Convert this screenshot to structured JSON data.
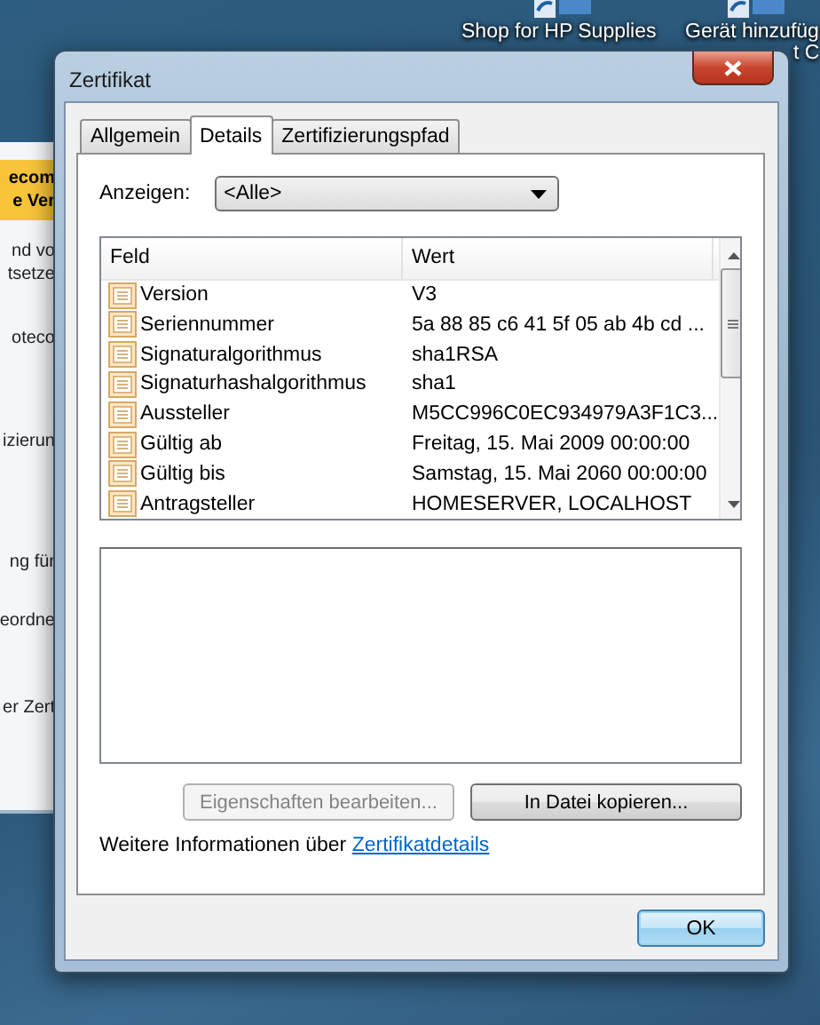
{
  "desktop": {
    "icons": [
      {
        "label": "Shop for HP Supplies"
      },
      {
        "label": "Gerät hinzufüg",
        "label_line_2": "t C"
      }
    ],
    "background_window": {
      "header_lines": [
        "ecom",
        "e Ver"
      ],
      "lines": [
        "nd vo",
        "tsetze",
        "oteco",
        "izierun",
        "ng für",
        "eordne",
        "er Zert"
      ]
    }
  },
  "window": {
    "title": "Zertifikat"
  },
  "tabs": [
    {
      "label": "Allgemein",
      "selected": false
    },
    {
      "label": "Details",
      "selected": true
    },
    {
      "label": "Zertifizierungspfad",
      "selected": false
    }
  ],
  "show_filter": {
    "label": "Anzeigen:",
    "value": "<Alle>"
  },
  "table": {
    "columns": [
      "Feld",
      "Wert"
    ],
    "rows": [
      {
        "field": "Version",
        "value": "V3"
      },
      {
        "field": "Seriennummer",
        "value": "5a 88 85 c6 41 5f 05 ab 4b cd ..."
      },
      {
        "field": "Signaturalgorithmus",
        "value": "sha1RSA"
      },
      {
        "field": "Signaturhashalgorithmus",
        "value": "sha1"
      },
      {
        "field": "Aussteller",
        "value": "M5CC996C0EC934979A3F1C3..."
      },
      {
        "field": "Gültig ab",
        "value": "Freitag, 15. Mai 2009 00:00:00"
      },
      {
        "field": "Gültig bis",
        "value": "Samstag, 15. Mai 2060 00:00:00"
      },
      {
        "field": "Antragsteller",
        "value": "HOMESERVER, LOCALHOST"
      }
    ]
  },
  "buttons": [
    {
      "label": "Eigenschaften bearbeiten...",
      "disabled": true
    },
    {
      "label": "In Datei kopieren...",
      "disabled": false
    }
  ],
  "info": {
    "text": "Weitere Informationen über",
    "link": "Zertifikatdetails"
  },
  "ok_button": {
    "label": "OK"
  }
}
